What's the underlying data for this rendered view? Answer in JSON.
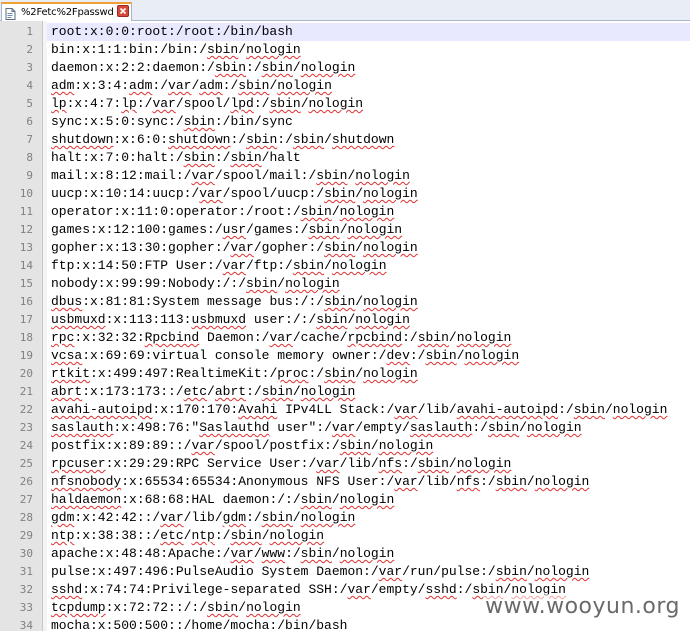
{
  "tab": {
    "title": "%2Fetc%2Fpasswd",
    "icon": "document-icon",
    "close_icon": "close-icon"
  },
  "colors": {
    "current_line": "#e8e8ff",
    "gutter": "#e4e4e4",
    "spell_underline": "#e03030",
    "tab_accent": "#f0a030"
  },
  "lines": [
    {
      "num": "1",
      "segs": [
        {
          "t": "root:x:0:0:root:/root:/bin/bash"
        }
      ]
    },
    {
      "num": "2",
      "segs": [
        {
          "t": "bin:x:1:1:bin:/bin:/"
        },
        {
          "t": "sbin",
          "s": 1
        },
        {
          "t": "/"
        },
        {
          "t": "nologin",
          "s": 1
        }
      ]
    },
    {
      "num": "3",
      "segs": [
        {
          "t": "daemon:x:2:2:daemon:/"
        },
        {
          "t": "sbin",
          "s": 1
        },
        {
          "t": ":/"
        },
        {
          "t": "sbin",
          "s": 1
        },
        {
          "t": "/"
        },
        {
          "t": "nologin",
          "s": 1
        }
      ]
    },
    {
      "num": "4",
      "segs": [
        {
          "t": "adm",
          "s": 1
        },
        {
          "t": ":x:3:4:"
        },
        {
          "t": "adm",
          "s": 1
        },
        {
          "t": ":/"
        },
        {
          "t": "var",
          "s": 1
        },
        {
          "t": "/"
        },
        {
          "t": "adm",
          "s": 1
        },
        {
          "t": ":/"
        },
        {
          "t": "sbin",
          "s": 1
        },
        {
          "t": "/"
        },
        {
          "t": "nologin",
          "s": 1
        }
      ]
    },
    {
      "num": "5",
      "segs": [
        {
          "t": "lp",
          "s": 1
        },
        {
          "t": ":x:4:7:"
        },
        {
          "t": "lp",
          "s": 1
        },
        {
          "t": ":/"
        },
        {
          "t": "var",
          "s": 1
        },
        {
          "t": "/spool/"
        },
        {
          "t": "lpd",
          "s": 1
        },
        {
          "t": ":/"
        },
        {
          "t": "sbin",
          "s": 1
        },
        {
          "t": "/"
        },
        {
          "t": "nologin",
          "s": 1
        }
      ]
    },
    {
      "num": "6",
      "segs": [
        {
          "t": "sync:x:5:0:sync:/"
        },
        {
          "t": "sbin",
          "s": 1
        },
        {
          "t": ":/bin/sync"
        }
      ]
    },
    {
      "num": "7",
      "segs": [
        {
          "t": "shutdown",
          "s": 1
        },
        {
          "t": ":x:6:0:"
        },
        {
          "t": "shutdown",
          "s": 1
        },
        {
          "t": ":/"
        },
        {
          "t": "sbin",
          "s": 1
        },
        {
          "t": ":/"
        },
        {
          "t": "sbin",
          "s": 1
        },
        {
          "t": "/"
        },
        {
          "t": "shutdown",
          "s": 1
        }
      ]
    },
    {
      "num": "8",
      "segs": [
        {
          "t": "halt:x:7:0:halt:/"
        },
        {
          "t": "sbin",
          "s": 1
        },
        {
          "t": ":/"
        },
        {
          "t": "sbin",
          "s": 1
        },
        {
          "t": "/halt"
        }
      ]
    },
    {
      "num": "9",
      "segs": [
        {
          "t": "mail:x:8:12:mail:/"
        },
        {
          "t": "var",
          "s": 1
        },
        {
          "t": "/spool/mail:/"
        },
        {
          "t": "sbin",
          "s": 1
        },
        {
          "t": "/"
        },
        {
          "t": "nologin",
          "s": 1
        }
      ]
    },
    {
      "num": "10",
      "segs": [
        {
          "t": "uucp:x:10:14:uucp:/"
        },
        {
          "t": "var",
          "s": 1
        },
        {
          "t": "/spool/uucp:/"
        },
        {
          "t": "sbin",
          "s": 1
        },
        {
          "t": "/"
        },
        {
          "t": "nologin",
          "s": 1
        }
      ]
    },
    {
      "num": "11",
      "segs": [
        {
          "t": "operator:x:11:0:operator:/root:/"
        },
        {
          "t": "sbin",
          "s": 1
        },
        {
          "t": "/"
        },
        {
          "t": "nologin",
          "s": 1
        }
      ]
    },
    {
      "num": "12",
      "segs": [
        {
          "t": "games:x:12:100:games:/"
        },
        {
          "t": "usr",
          "s": 1
        },
        {
          "t": "/games:/"
        },
        {
          "t": "sbin",
          "s": 1
        },
        {
          "t": "/"
        },
        {
          "t": "nologin",
          "s": 1
        }
      ]
    },
    {
      "num": "13",
      "segs": [
        {
          "t": "gopher:x:13:30:gopher:/"
        },
        {
          "t": "var",
          "s": 1
        },
        {
          "t": "/gopher:/"
        },
        {
          "t": "sbin",
          "s": 1
        },
        {
          "t": "/"
        },
        {
          "t": "nologin",
          "s": 1
        }
      ]
    },
    {
      "num": "14",
      "segs": [
        {
          "t": "ftp:x:14:50:FTP User:/"
        },
        {
          "t": "var",
          "s": 1
        },
        {
          "t": "/ftp:/"
        },
        {
          "t": "sbin",
          "s": 1
        },
        {
          "t": "/"
        },
        {
          "t": "nologin",
          "s": 1
        }
      ]
    },
    {
      "num": "15",
      "segs": [
        {
          "t": "nobody:x:99:99:Nobody:/:/"
        },
        {
          "t": "sbin",
          "s": 1
        },
        {
          "t": "/"
        },
        {
          "t": "nologin",
          "s": 1
        }
      ]
    },
    {
      "num": "16",
      "segs": [
        {
          "t": "dbus",
          "s": 1
        },
        {
          "t": ":x:81:81:System message bus:/:/"
        },
        {
          "t": "sbin",
          "s": 1
        },
        {
          "t": "/"
        },
        {
          "t": "nologin",
          "s": 1
        }
      ]
    },
    {
      "num": "17",
      "segs": [
        {
          "t": "usbmuxd",
          "s": 1
        },
        {
          "t": ":x:113:113:"
        },
        {
          "t": "usbmuxd",
          "s": 1
        },
        {
          "t": " user:/:/"
        },
        {
          "t": "sbin",
          "s": 1
        },
        {
          "t": "/"
        },
        {
          "t": "nologin",
          "s": 1
        }
      ]
    },
    {
      "num": "18",
      "segs": [
        {
          "t": "rpc",
          "s": 1
        },
        {
          "t": ":x:32:32:"
        },
        {
          "t": "Rpcbind",
          "s": 1
        },
        {
          "t": " Daemon:/"
        },
        {
          "t": "var",
          "s": 1
        },
        {
          "t": "/cache/"
        },
        {
          "t": "rpcbind",
          "s": 1
        },
        {
          "t": ":/"
        },
        {
          "t": "sbin",
          "s": 1
        },
        {
          "t": "/"
        },
        {
          "t": "nologin",
          "s": 1
        }
      ]
    },
    {
      "num": "19",
      "segs": [
        {
          "t": "vcsa",
          "s": 1
        },
        {
          "t": ":x:69:69:virtual console memory owner:/"
        },
        {
          "t": "dev",
          "s": 1
        },
        {
          "t": ":/"
        },
        {
          "t": "sbin",
          "s": 1
        },
        {
          "t": "/"
        },
        {
          "t": "nologin",
          "s": 1
        }
      ]
    },
    {
      "num": "20",
      "segs": [
        {
          "t": "rtkit",
          "s": 1
        },
        {
          "t": ":x:499:497:RealtimeKit:/"
        },
        {
          "t": "proc",
          "s": 1
        },
        {
          "t": ":/"
        },
        {
          "t": "sbin",
          "s": 1
        },
        {
          "t": "/"
        },
        {
          "t": "nologin",
          "s": 1
        }
      ]
    },
    {
      "num": "21",
      "segs": [
        {
          "t": "abrt",
          "s": 1
        },
        {
          "t": ":x:173:173::/"
        },
        {
          "t": "etc",
          "s": 1
        },
        {
          "t": "/"
        },
        {
          "t": "abrt",
          "s": 1
        },
        {
          "t": ":/"
        },
        {
          "t": "sbin",
          "s": 1
        },
        {
          "t": "/"
        },
        {
          "t": "nologin",
          "s": 1
        }
      ]
    },
    {
      "num": "22",
      "segs": [
        {
          "t": "avahi-autoipd",
          "s": 1
        },
        {
          "t": ":x:170:170:"
        },
        {
          "t": "Avahi",
          "s": 1
        },
        {
          "t": " IPv4LL Stack:/"
        },
        {
          "t": "var",
          "s": 1
        },
        {
          "t": "/lib/"
        },
        {
          "t": "avahi-autoipd",
          "s": 1
        },
        {
          "t": ":/"
        },
        {
          "t": "sbin",
          "s": 1
        },
        {
          "t": "/"
        },
        {
          "t": "nologin",
          "s": 1
        }
      ]
    },
    {
      "num": "23",
      "segs": [
        {
          "t": "saslauth",
          "s": 1
        },
        {
          "t": ":x:498:76:\""
        },
        {
          "t": "Saslauthd",
          "s": 1
        },
        {
          "t": " user\":/"
        },
        {
          "t": "var",
          "s": 1
        },
        {
          "t": "/empty/"
        },
        {
          "t": "saslauth",
          "s": 1
        },
        {
          "t": ":/"
        },
        {
          "t": "sbin",
          "s": 1
        },
        {
          "t": "/"
        },
        {
          "t": "nologin",
          "s": 1
        }
      ]
    },
    {
      "num": "24",
      "segs": [
        {
          "t": "postfix:x:89:89::/"
        },
        {
          "t": "var",
          "s": 1
        },
        {
          "t": "/spool/postfix:/"
        },
        {
          "t": "sbin",
          "s": 1
        },
        {
          "t": "/"
        },
        {
          "t": "nologin",
          "s": 1
        }
      ]
    },
    {
      "num": "25",
      "segs": [
        {
          "t": "rpcuser",
          "s": 1
        },
        {
          "t": ":x:29:29:RPC Service User:/"
        },
        {
          "t": "var",
          "s": 1
        },
        {
          "t": "/lib/"
        },
        {
          "t": "nfs",
          "s": 1
        },
        {
          "t": ":/"
        },
        {
          "t": "sbin",
          "s": 1
        },
        {
          "t": "/"
        },
        {
          "t": "nologin",
          "s": 1
        }
      ]
    },
    {
      "num": "26",
      "segs": [
        {
          "t": "nfsnobody",
          "s": 1
        },
        {
          "t": ":x:65534:65534:Anonymous NFS User:/"
        },
        {
          "t": "var",
          "s": 1
        },
        {
          "t": "/lib/"
        },
        {
          "t": "nfs",
          "s": 1
        },
        {
          "t": ":/"
        },
        {
          "t": "sbin",
          "s": 1
        },
        {
          "t": "/"
        },
        {
          "t": "nologin",
          "s": 1
        }
      ]
    },
    {
      "num": "27",
      "segs": [
        {
          "t": "haldaemon",
          "s": 1
        },
        {
          "t": ":x:68:68:HAL daemon:/:/"
        },
        {
          "t": "sbin",
          "s": 1
        },
        {
          "t": "/"
        },
        {
          "t": "nologin",
          "s": 1
        }
      ]
    },
    {
      "num": "28",
      "segs": [
        {
          "t": "gdm",
          "s": 1
        },
        {
          "t": ":x:42:42::/"
        },
        {
          "t": "var",
          "s": 1
        },
        {
          "t": "/lib/"
        },
        {
          "t": "gdm",
          "s": 1
        },
        {
          "t": ":/"
        },
        {
          "t": "sbin",
          "s": 1
        },
        {
          "t": "/"
        },
        {
          "t": "nologin",
          "s": 1
        }
      ]
    },
    {
      "num": "29",
      "segs": [
        {
          "t": "ntp",
          "s": 1
        },
        {
          "t": ":x:38:38::/"
        },
        {
          "t": "etc",
          "s": 1
        },
        {
          "t": "/"
        },
        {
          "t": "ntp",
          "s": 1
        },
        {
          "t": ":/"
        },
        {
          "t": "sbin",
          "s": 1
        },
        {
          "t": "/"
        },
        {
          "t": "nologin",
          "s": 1
        }
      ]
    },
    {
      "num": "30",
      "segs": [
        {
          "t": "apache:x:48:48:Apache:/"
        },
        {
          "t": "var",
          "s": 1
        },
        {
          "t": "/"
        },
        {
          "t": "www",
          "s": 1
        },
        {
          "t": ":/"
        },
        {
          "t": "sbin",
          "s": 1
        },
        {
          "t": "/"
        },
        {
          "t": "nologin",
          "s": 1
        }
      ]
    },
    {
      "num": "31",
      "segs": [
        {
          "t": "pulse:x:497:496:PulseAudio System Daemon:/"
        },
        {
          "t": "var",
          "s": 1
        },
        {
          "t": "/run/pulse:/"
        },
        {
          "t": "sbin",
          "s": 1
        },
        {
          "t": "/"
        },
        {
          "t": "nologin",
          "s": 1
        }
      ]
    },
    {
      "num": "32",
      "segs": [
        {
          "t": "sshd",
          "s": 1
        },
        {
          "t": ":x:74:74:Privilege-separated SSH:/"
        },
        {
          "t": "var",
          "s": 1
        },
        {
          "t": "/empty/"
        },
        {
          "t": "sshd",
          "s": 1
        },
        {
          "t": ":/"
        },
        {
          "t": "sbin",
          "s": 1
        },
        {
          "t": "/"
        },
        {
          "t": "nologin",
          "s": 1
        }
      ]
    },
    {
      "num": "33",
      "segs": [
        {
          "t": "tcpdump",
          "s": 1
        },
        {
          "t": ":x:72:72::/:/"
        },
        {
          "t": "sbin",
          "s": 1
        },
        {
          "t": "/"
        },
        {
          "t": "nologin",
          "s": 1
        }
      ]
    },
    {
      "num": "34",
      "segs": [
        {
          "t": "mocha:x:500:500::/home/mocha:/bin/bash"
        }
      ]
    }
  ],
  "watermark": "www.wooyun.org"
}
